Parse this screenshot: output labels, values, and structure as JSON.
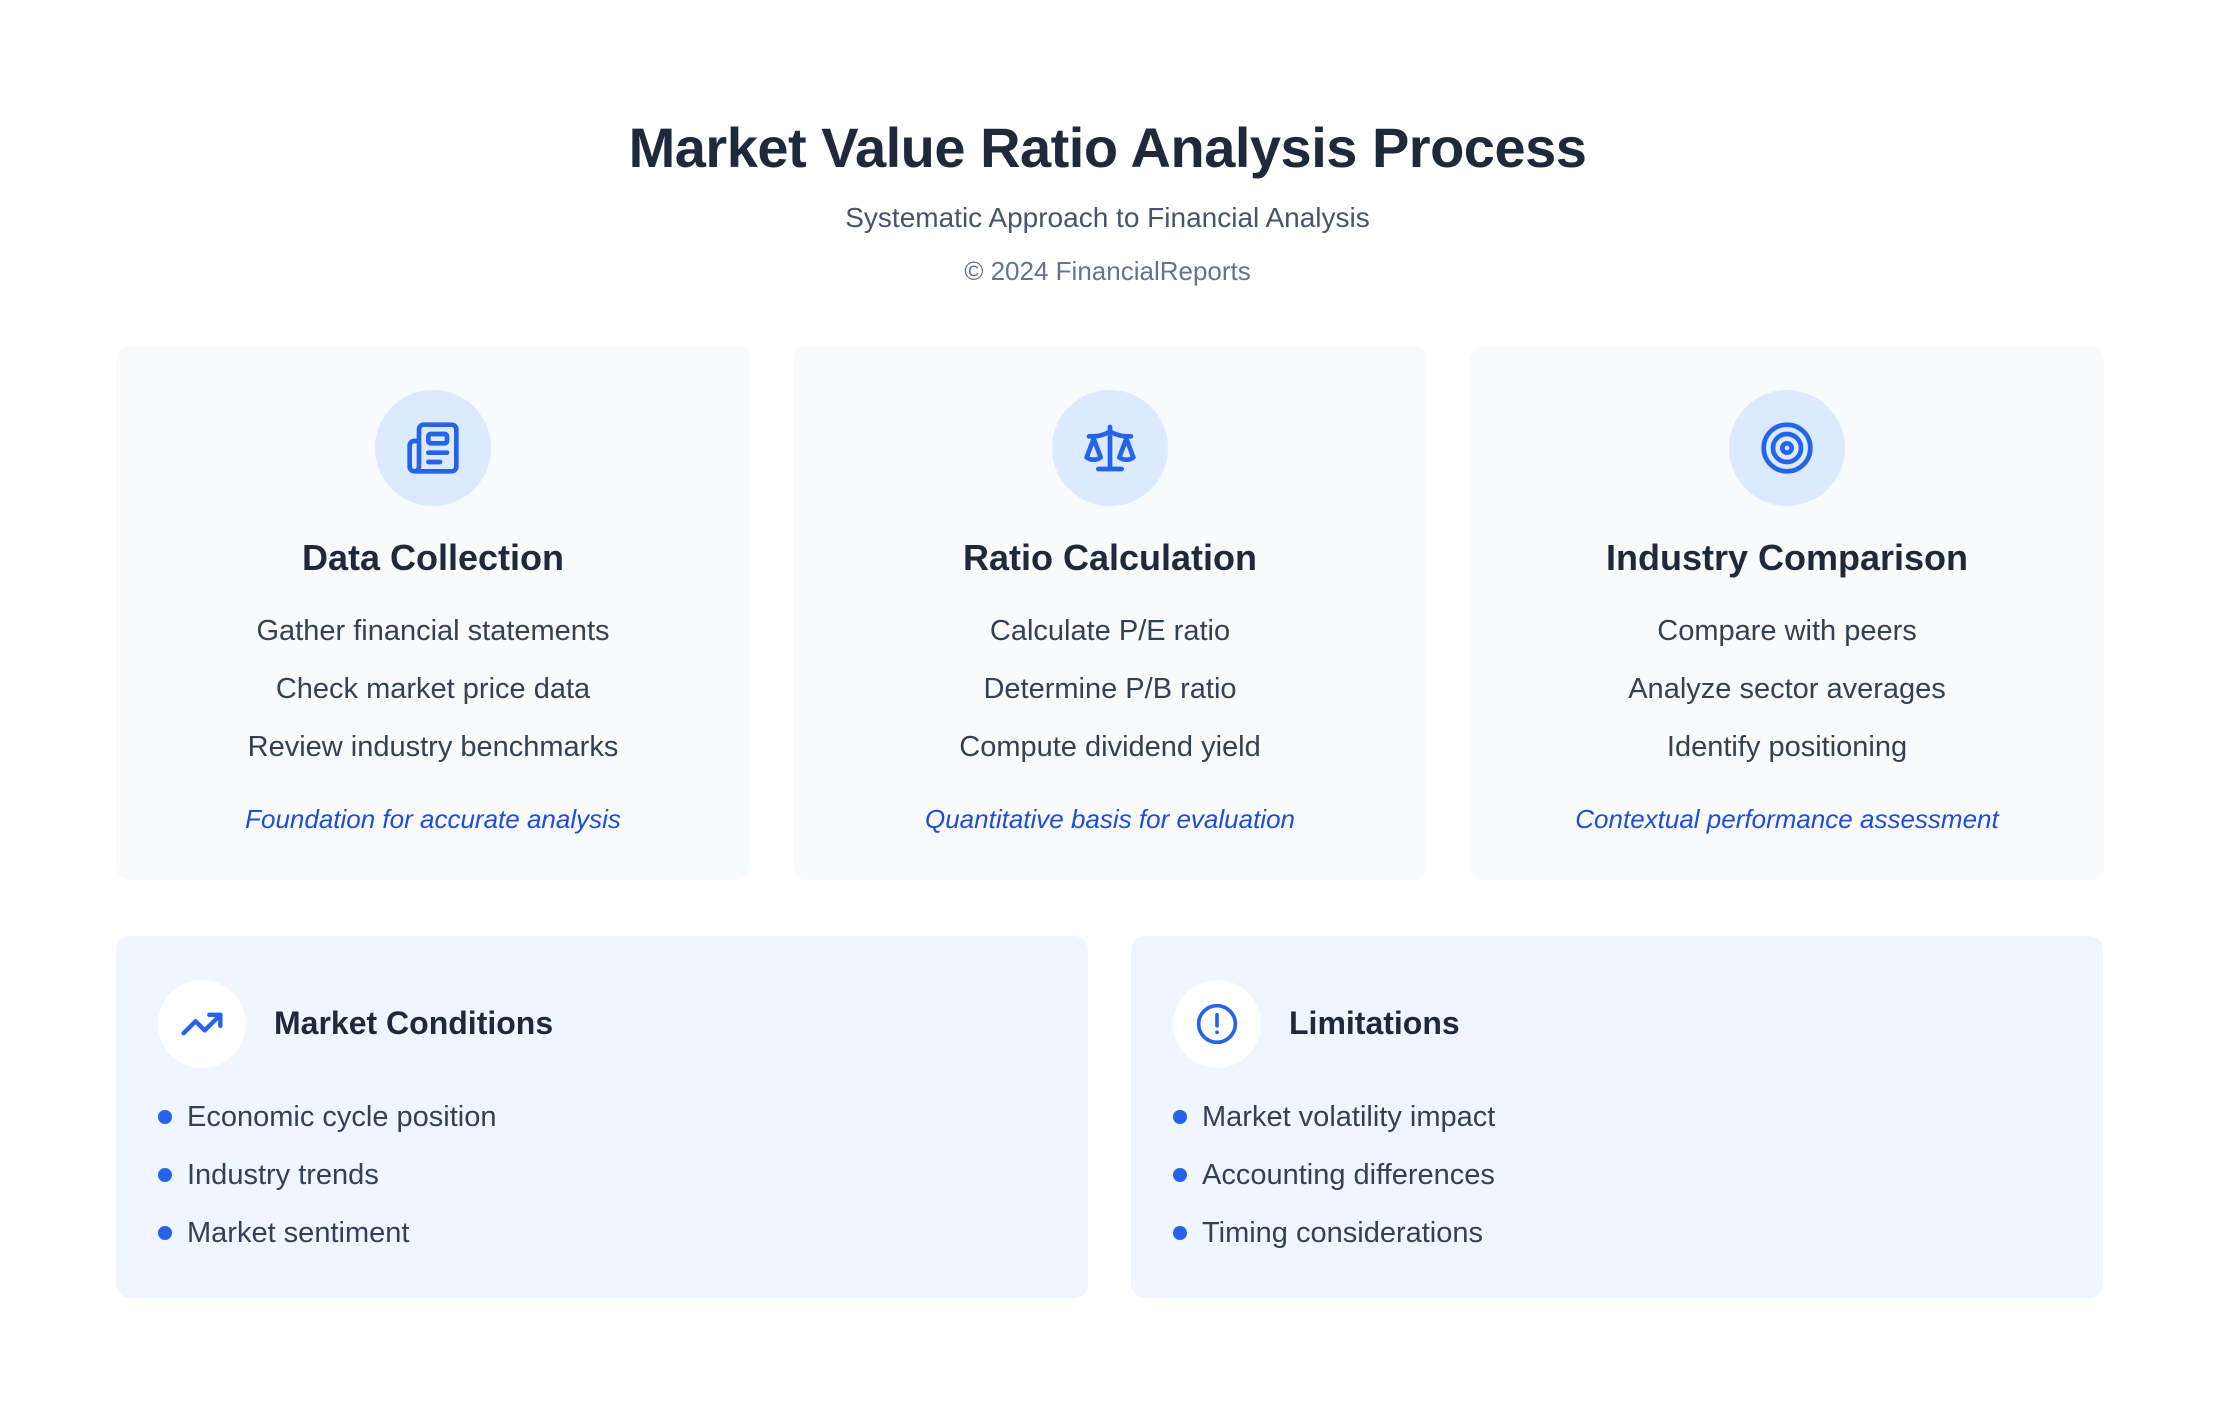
{
  "header": {
    "title": "Market Value Ratio Analysis Process",
    "subtitle": "Systematic Approach to Financial Analysis",
    "copyright": "© 2024 FinancialReports"
  },
  "colors": {
    "accent": "#2563eb",
    "note": "#1d4ed8",
    "card_bg": "#f8fafc",
    "panel_bg": "#eff6ff",
    "icon_bg": "#dbeafe"
  },
  "cards": [
    {
      "icon": "newspaper-icon",
      "title": "Data Collection",
      "items": [
        "Gather financial statements",
        "Check market price data",
        "Review industry benchmarks"
      ],
      "note": "Foundation for accurate analysis"
    },
    {
      "icon": "balance-scale-icon",
      "title": "Ratio Calculation",
      "items": [
        "Calculate P/E ratio",
        "Determine P/B ratio",
        "Compute dividend yield"
      ],
      "note": "Quantitative basis for evaluation"
    },
    {
      "icon": "target-icon",
      "title": "Industry Comparison",
      "items": [
        "Compare with peers",
        "Analyze sector averages",
        "Identify positioning"
      ],
      "note": "Contextual performance assessment"
    }
  ],
  "panels": [
    {
      "icon": "trending-up-icon",
      "title": "Market Conditions",
      "items": [
        "Economic cycle position",
        "Industry trends",
        "Market sentiment"
      ]
    },
    {
      "icon": "exclamation-circle-icon",
      "title": "Limitations",
      "items": [
        "Market volatility impact",
        "Accounting differences",
        "Timing considerations"
      ]
    }
  ]
}
